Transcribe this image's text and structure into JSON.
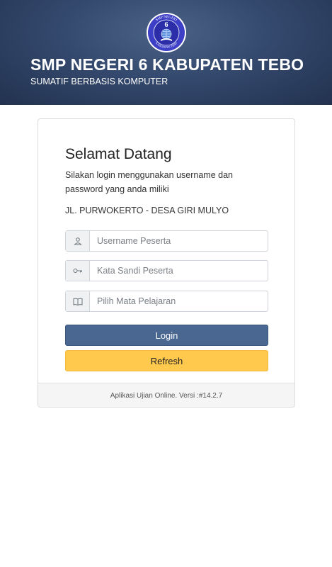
{
  "header": {
    "logo_text_top": "SMP NEGERI",
    "logo_number": "6",
    "logo_text_bottom": "KABUPATEN TEBO",
    "school_name": "SMP NEGERI 6 KABUPATEN TEBO",
    "subtitle": "SUMATIF BERBASIS KOMPUTER"
  },
  "card": {
    "welcome": "Selamat Datang",
    "intro": "Silakan login menggunakan username dan password yang anda miliki",
    "address": "JL. PURWOKERTO - DESA GIRI MULYO",
    "fields": {
      "username": {
        "placeholder": "Username Peserta",
        "icon": "user-icon"
      },
      "password": {
        "placeholder": "Kata Sandi Peserta",
        "icon": "key-icon"
      },
      "subject": {
        "placeholder": "Pilih Mata Pelajaran",
        "icon": "book-icon"
      }
    },
    "buttons": {
      "login": "Login",
      "refresh": "Refresh"
    },
    "footer": "Aplikasi Ujian Online. Versi :#14.2.7"
  },
  "colors": {
    "header_bg": "#34496e",
    "login_button": "#4a6791",
    "refresh_button": "#ffc94d"
  }
}
